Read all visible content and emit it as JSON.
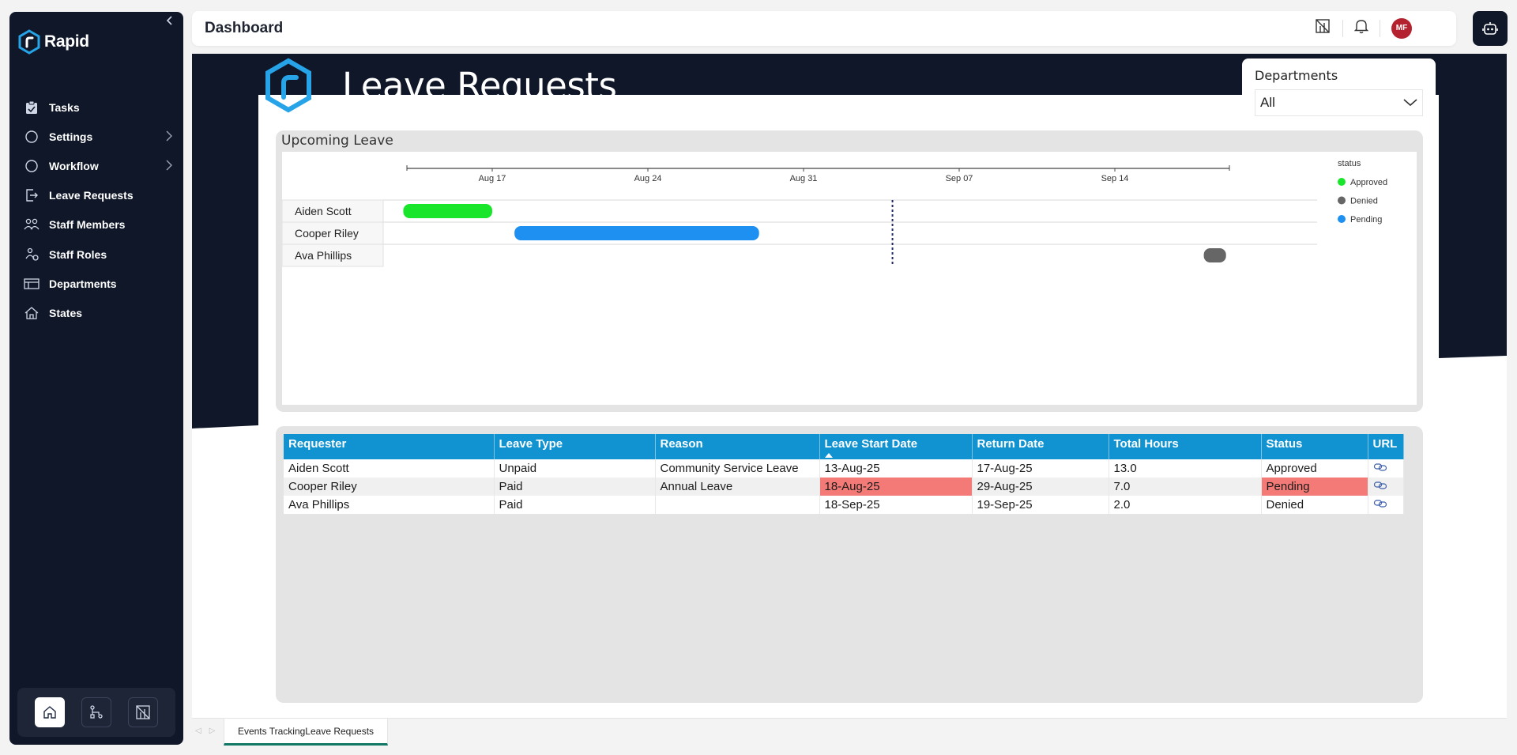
{
  "sidebar": {
    "brand": "Rapid",
    "items": [
      {
        "label": "Tasks",
        "icon": "clipboard-icon",
        "has_children": false
      },
      {
        "label": "Settings",
        "icon": "circle-icon",
        "has_children": true
      },
      {
        "label": "Workflow",
        "icon": "circle-icon",
        "has_children": true
      },
      {
        "label": "Leave Requests",
        "icon": "exit-icon",
        "has_children": false
      },
      {
        "label": "Staff Members",
        "icon": "people-icon",
        "has_children": false
      },
      {
        "label": "Staff Roles",
        "icon": "roles-icon",
        "has_children": false
      },
      {
        "label": "Departments",
        "icon": "building-icon",
        "has_children": false
      },
      {
        "label": "States",
        "icon": "house-icon",
        "has_children": false
      }
    ],
    "bottom_buttons": [
      "home-icon",
      "workflow-icon",
      "powerbi-icon"
    ]
  },
  "header": {
    "title": "Dashboard",
    "avatar_initials": "MF"
  },
  "report": {
    "title": "Leave Requests",
    "filter": {
      "label": "Departments",
      "value": "All"
    },
    "upcoming_title": "Upcoming Leave"
  },
  "chart_data": {
    "type": "gantt",
    "title": "Upcoming Leave",
    "x_ticks": [
      "Aug 17",
      "Aug 24",
      "Aug 31",
      "Sep 07",
      "Sep 14"
    ],
    "x_range": [
      "2025-08-13",
      "2025-09-19"
    ],
    "today_marker": "2025-09-04",
    "legend_title": "status",
    "legend": [
      {
        "name": "Approved",
        "color": "#19e62a"
      },
      {
        "name": "Denied",
        "color": "#666666"
      },
      {
        "name": "Pending",
        "color": "#1e90f2"
      }
    ],
    "rows": [
      {
        "name": "Aiden Scott",
        "start": "2025-08-13",
        "end": "2025-08-17",
        "status": "Approved"
      },
      {
        "name": "Cooper Riley",
        "start": "2025-08-18",
        "end": "2025-08-29",
        "status": "Pending"
      },
      {
        "name": "Ava Phillips",
        "start": "2025-09-18",
        "end": "2025-09-19",
        "status": "Denied"
      }
    ]
  },
  "table": {
    "columns": [
      "Requester",
      "Leave Type",
      "Reason",
      "Leave Start Date",
      "Return Date",
      "Total Hours",
      "Status",
      "URL"
    ],
    "sorted_column": 3,
    "rows": [
      {
        "cells": [
          "Aiden Scott",
          "Unpaid",
          "Community Service Leave",
          "13-Aug-25",
          "17-Aug-25",
          "13.0",
          "Approved",
          ""
        ],
        "highlight": []
      },
      {
        "cells": [
          "Cooper Riley",
          "Paid",
          "Annual Leave",
          "18-Aug-25",
          "29-Aug-25",
          "7.0",
          "Pending",
          ""
        ],
        "highlight": [
          3,
          6
        ]
      },
      {
        "cells": [
          "Ava Phillips",
          "Paid",
          "",
          "18-Sep-25",
          "19-Sep-25",
          "2.0",
          "Denied",
          ""
        ],
        "highlight": []
      }
    ]
  },
  "footer": {
    "page_tab": "Events TrackingLeave Requests"
  },
  "colors": {
    "sidebar_bg": "#0f1729",
    "header_accent": "#1193d1",
    "highlight": "#f37a76",
    "avatar": "#b3222e",
    "tab_accent": "#117865"
  }
}
